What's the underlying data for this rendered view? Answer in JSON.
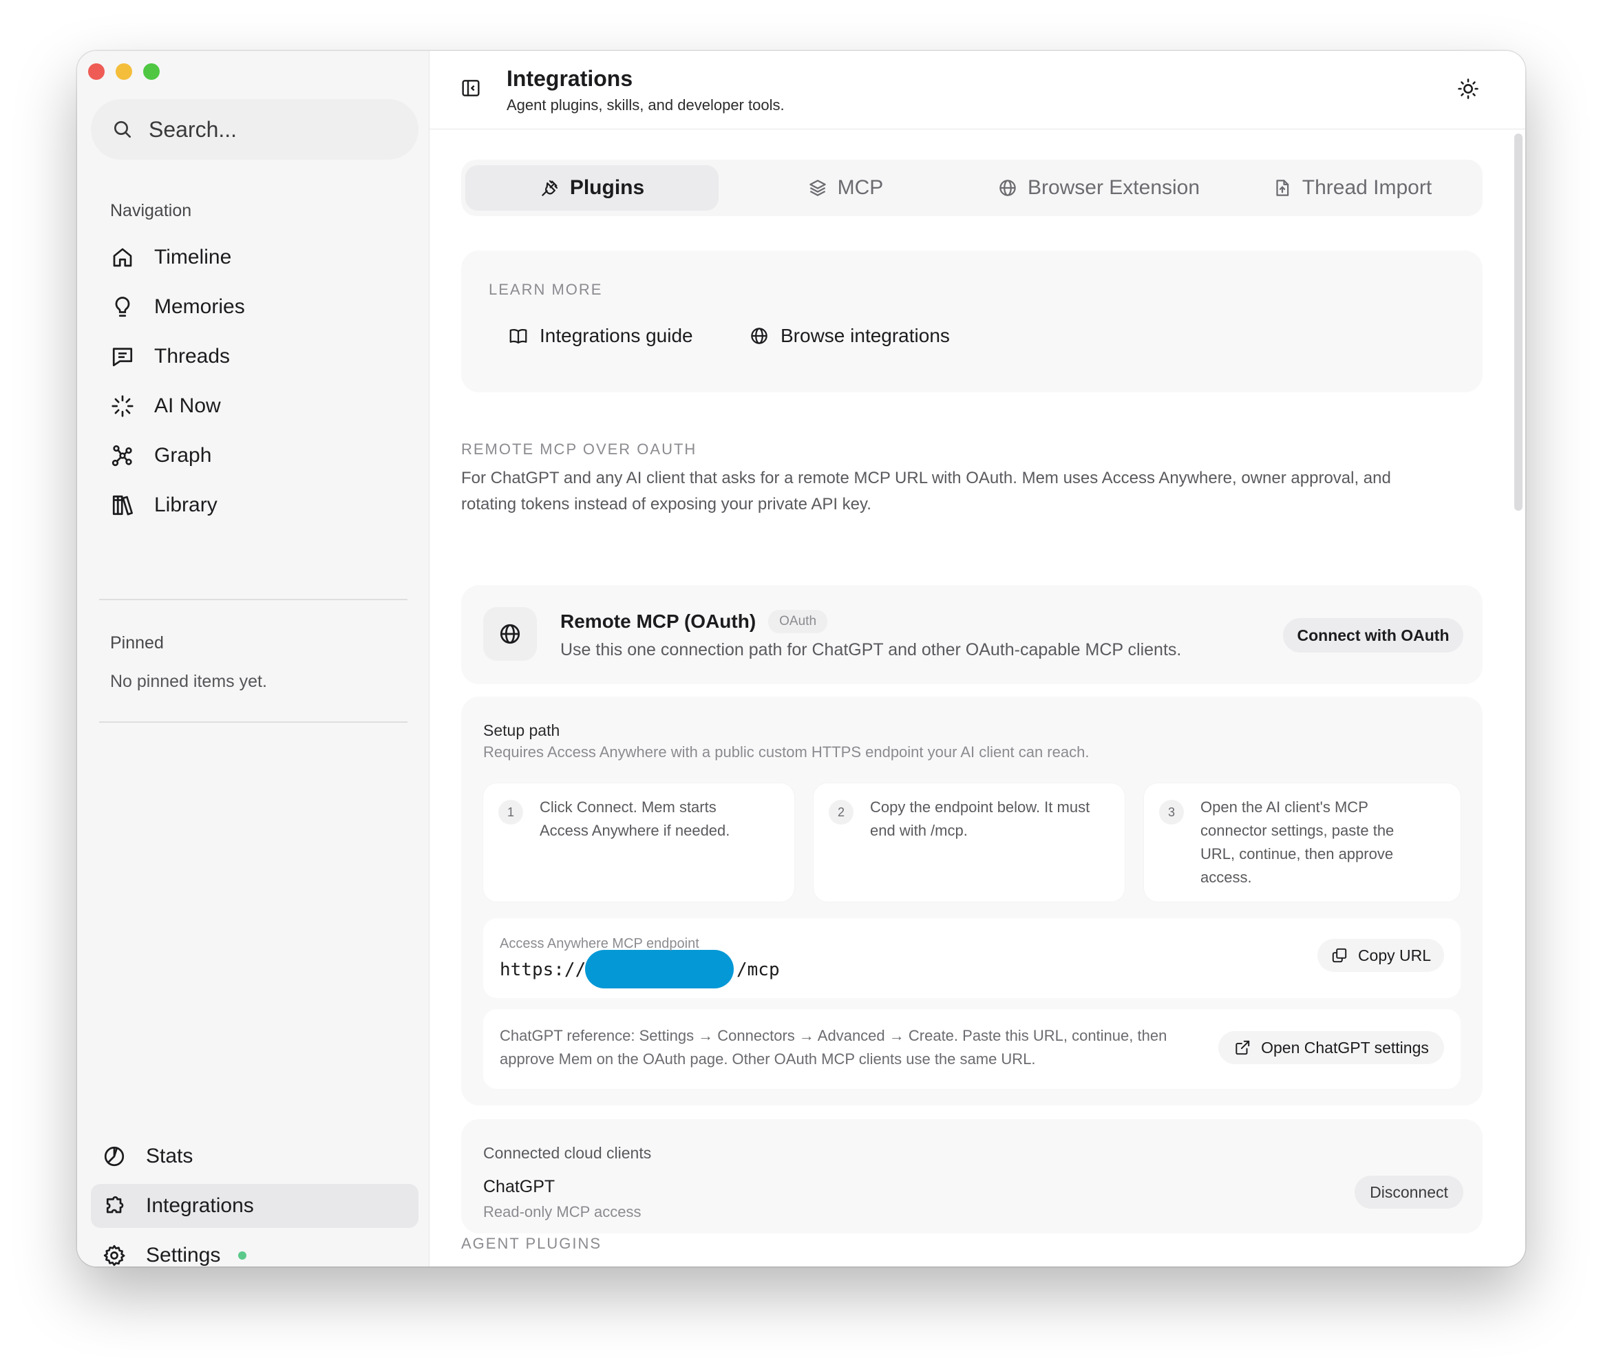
{
  "sidebar": {
    "search_label": "Search...",
    "navigation_label": "Navigation",
    "nav_items": [
      {
        "label": "Timeline",
        "icon": "home-icon"
      },
      {
        "label": "Memories",
        "icon": "lightbulb-icon"
      },
      {
        "label": "Threads",
        "icon": "chat-icon"
      },
      {
        "label": "AI Now",
        "icon": "spinner-icon"
      },
      {
        "label": "Graph",
        "icon": "graph-icon"
      },
      {
        "label": "Library",
        "icon": "library-icon"
      }
    ],
    "pinned_label": "Pinned",
    "pinned_empty": "No pinned items yet.",
    "bottom_items": [
      {
        "label": "Stats",
        "icon": "pie-chart-icon"
      },
      {
        "label": "Integrations",
        "icon": "puzzle-icon",
        "active": true
      },
      {
        "label": "Settings",
        "icon": "gear-icon",
        "status_color": "#5cc98a"
      }
    ]
  },
  "header": {
    "title": "Integrations",
    "subtitle": "Agent plugins, skills, and developer tools."
  },
  "tabs": [
    {
      "label": "Plugins",
      "icon": "plug-icon",
      "active": true
    },
    {
      "label": "MCP",
      "icon": "layers-icon"
    },
    {
      "label": "Browser Extension",
      "icon": "globe-icon"
    },
    {
      "label": "Thread Import",
      "icon": "file-import-icon"
    }
  ],
  "learn_more": {
    "heading": "LEARN MORE",
    "links": [
      {
        "label": "Integrations guide",
        "icon": "book-icon"
      },
      {
        "label": "Browse integrations",
        "icon": "globe-icon"
      }
    ]
  },
  "remote_mcp": {
    "heading": "REMOTE MCP OVER OAUTH",
    "description_line1": "For ChatGPT and any AI client that asks for a remote MCP URL with OAuth. Mem uses Access Anywhere, owner approval, and",
    "description_line2": "rotating tokens instead of exposing your private API key.",
    "card_title": "Remote MCP (OAuth)",
    "card_badge": "OAuth",
    "card_desc": "Use this one connection path for ChatGPT and other OAuth-capable MCP clients.",
    "connect_label": "Connect with OAuth"
  },
  "setup": {
    "title": "Setup path",
    "subtitle": "Requires Access Anywhere with a public custom HTTPS endpoint your AI client can reach.",
    "steps": [
      {
        "num": "1",
        "line1": "Click Connect. Mem starts",
        "line2": "Access Anywhere if needed.",
        "line3": "",
        "line4": ""
      },
      {
        "num": "2",
        "line1": "Copy the endpoint below. It must",
        "line2": "end with /mcp.",
        "line3": "",
        "line4": ""
      },
      {
        "num": "3",
        "line1": "Open the AI client's MCP",
        "line2": "connector settings, paste the",
        "line3": "URL, continue, then approve",
        "line4": "access."
      }
    ],
    "endpoint_label": "Access Anywhere MCP endpoint",
    "endpoint_prefix": "https://",
    "endpoint_suffix": "/mcp",
    "copy_label": "Copy URL",
    "reference_line1": "ChatGPT reference: Settings → Connectors → Advanced → Create. Paste this URL, continue, then",
    "reference_line2": "approve Mem on the OAuth page. Other OAuth MCP clients use the same URL.",
    "open_settings_label": "Open ChatGPT settings"
  },
  "connected": {
    "title": "Connected cloud clients",
    "client_name": "ChatGPT",
    "client_access": "Read-only MCP access",
    "disconnect_label": "Disconnect"
  },
  "agent_plugins_heading": "AGENT PLUGINS",
  "colors": {
    "redaction": "#0598d6",
    "settings_status": "#5cc98a"
  }
}
